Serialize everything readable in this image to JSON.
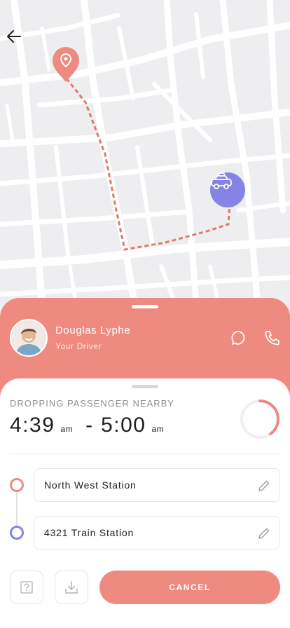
{
  "map": {
    "background_color": "#eeeef0",
    "road_color": "#ffffff",
    "route_color": "#e5786c",
    "pickup_icon": "location-pin-icon",
    "vehicle_icon": "taxi-icon"
  },
  "header": {
    "back_icon": "arrow-left-icon"
  },
  "driver": {
    "name": "Douglas Lyphe",
    "role": "Your Driver",
    "chat_icon": "chat-bubble-icon",
    "call_icon": "phone-icon"
  },
  "trip": {
    "status": "DROPPING PASSENGER NEARBY",
    "start_time": "4:39",
    "start_period": "am",
    "separator": "-",
    "end_time": "5:00",
    "end_period": "am",
    "progress_fraction": 0.4
  },
  "stops": [
    {
      "name": "North West Station",
      "edit_icon": "pencil-icon"
    },
    {
      "name": "4321 Train Station",
      "edit_icon": "pencil-icon"
    }
  ],
  "actions": {
    "help_icon": "question-mark-icon",
    "download_icon": "download-icon",
    "cancel_label": "CANCEL"
  },
  "colors": {
    "accent": "#ef8a80",
    "secondary": "#8683e6",
    "text": "#1f1f1f",
    "muted": "#8f8f8f"
  }
}
